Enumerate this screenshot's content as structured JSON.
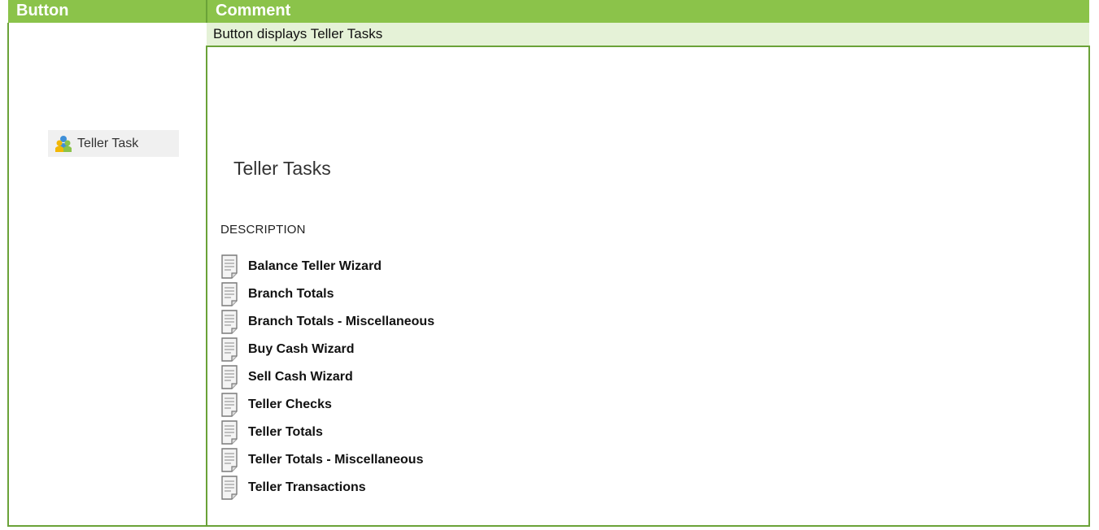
{
  "table": {
    "header_button": "Button",
    "header_comment": "Comment"
  },
  "row": {
    "description": "Button displays Teller Tasks",
    "button_label": "Teller Task",
    "panel_title": "Teller Tasks",
    "list_header": "DESCRIPTION",
    "items": [
      "Balance Teller Wizard",
      "Branch Totals",
      "Branch Totals - Miscellaneous",
      "Buy Cash Wizard",
      "Sell Cash Wizard",
      "Teller Checks",
      "Teller Totals",
      "Teller Totals - Miscellaneous",
      "Teller Transactions"
    ]
  },
  "icons": {
    "button_icon": "teller-people-icon",
    "item_icon": "document-icon"
  },
  "colors": {
    "header_green": "#8bc34a",
    "description_band": "#e5f2d7",
    "border_green": "#6aa238"
  }
}
